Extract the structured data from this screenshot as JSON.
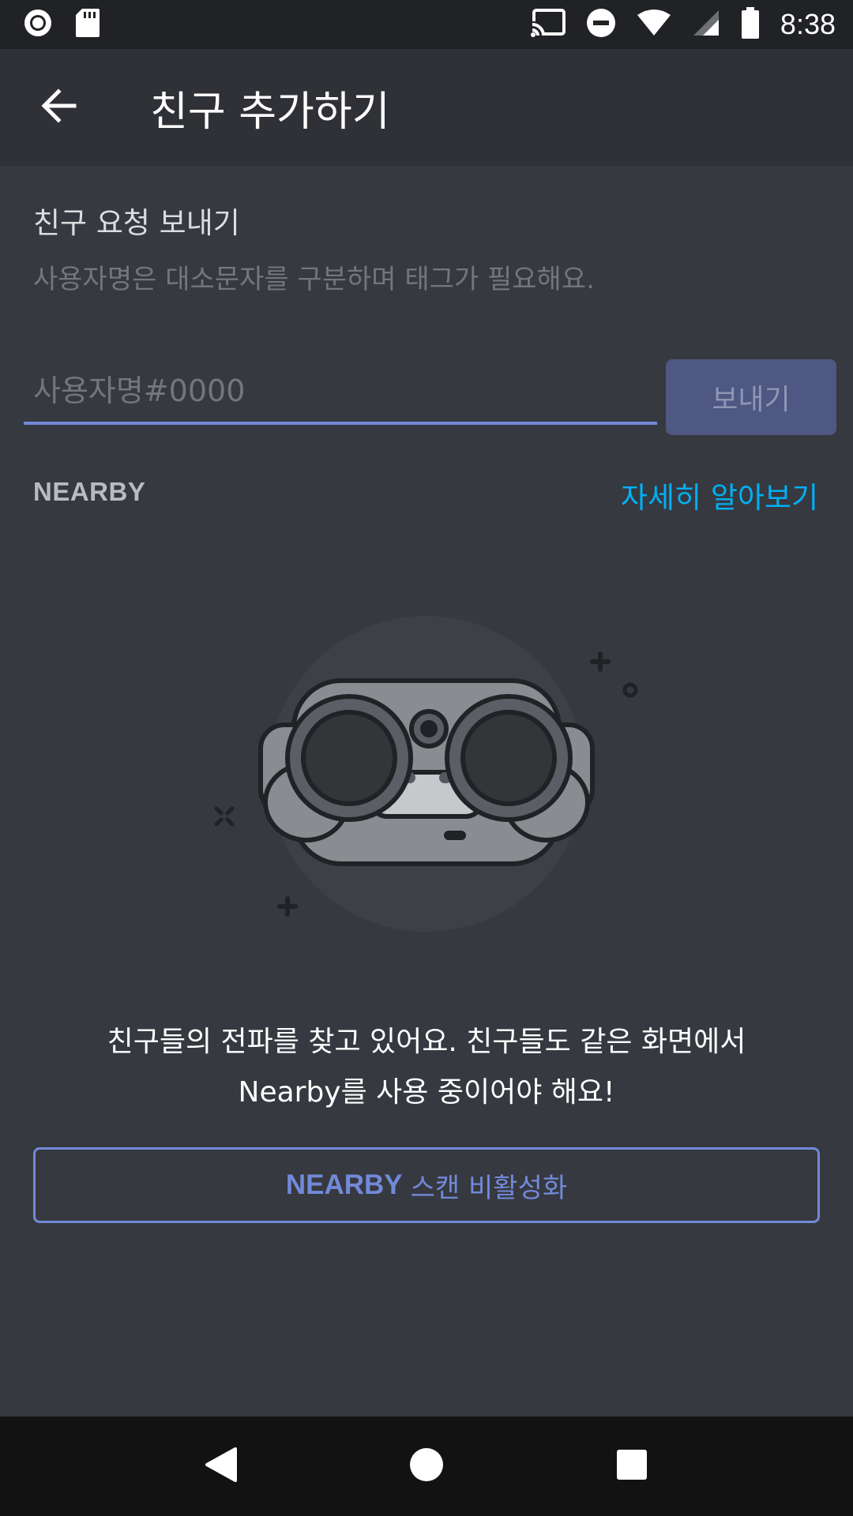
{
  "status_bar": {
    "time": "8:38",
    "icons": [
      "record-icon",
      "sd-card-icon",
      "cast-icon",
      "do-not-disturb-icon",
      "wifi-icon",
      "cellular-signal-icon",
      "battery-icon"
    ]
  },
  "app_bar": {
    "title": "친구 추가하기",
    "back_icon": "arrow-back-icon"
  },
  "friend_request": {
    "title": "친구 요청 보내기",
    "subtitle": "사용자명은 대소문자를 구분하며 태그가 필요해요.",
    "input_placeholder": "사용자명#0000",
    "input_value": "",
    "send_label": "보내기"
  },
  "nearby": {
    "label": "NEARBY",
    "learn_more": "자세히 알아보기",
    "description_line1": "친구들의 전파를 찾고 있어요. 친구들도 같은 화면에서",
    "description_line2": "Nearby를 사용 중이어야 해요!",
    "toggle_strong": "NEARBY",
    "toggle_rest": "스캔 비활성화"
  },
  "nav_bar": {
    "buttons": [
      "back-triangle-icon",
      "home-circle-icon",
      "recents-square-icon"
    ]
  },
  "colors": {
    "background": "#36393f",
    "app_bar": "#2f3136",
    "accent": "#7289da",
    "link": "#00b0f4",
    "send_button": "#4e5882"
  }
}
